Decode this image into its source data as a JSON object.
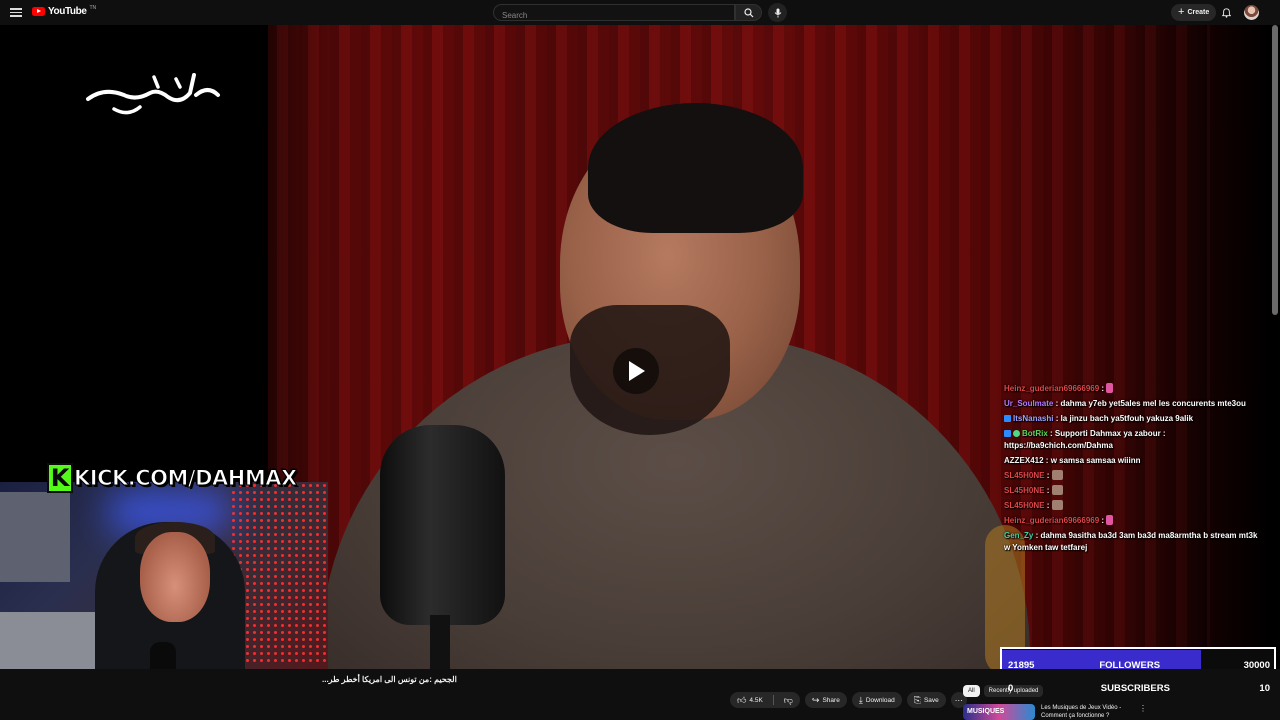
{
  "header": {
    "logo_text": "YouTube",
    "logo_region": "TN",
    "search_placeholder": "Search",
    "create_label": "Create",
    "icons": [
      "menu-icon",
      "search-icon",
      "mic-icon",
      "bell-icon"
    ]
  },
  "overlay": {
    "kick_url": "KICK.COM/DAHMAX"
  },
  "chat": [
    {
      "user": "Heinz_guderian69666969",
      "color": "#e0464a",
      "badge": "",
      "text": "",
      "emote": "pink"
    },
    {
      "user": "Ur_Soulmate",
      "color": "#b07cff",
      "badge": "",
      "text": "dahma y7eb yet5ales mel les concurents mte3ou",
      "emote": ""
    },
    {
      "user": "ItsNanashi",
      "color": "#9aa2ff",
      "badge": "square",
      "text": "la jinzu bach ya5tfouh yakuza 9alik",
      "emote": ""
    },
    {
      "user": "BotRix",
      "color": "#5cd65c",
      "badge": "both",
      "text": "Supporti Dahmax ya zabour : https://ba9chich.com/Dahma",
      "emote": ""
    },
    {
      "user": "AZZEX412",
      "color": "#f5f5f5",
      "badge": "",
      "text": "w samsa samsaa wiiinn",
      "emote": ""
    },
    {
      "user": "SL45H0NE",
      "color": "#e0464a",
      "badge": "",
      "text": "",
      "emote": "brown"
    },
    {
      "user": "SL45H0NE",
      "color": "#e0464a",
      "badge": "",
      "text": "",
      "emote": "brown"
    },
    {
      "user": "SL45H0NE",
      "color": "#e0464a",
      "badge": "",
      "text": "",
      "emote": "brown"
    },
    {
      "user": "Heinz_guderian69666969",
      "color": "#e0464a",
      "badge": "",
      "text": "",
      "emote": "pink"
    },
    {
      "user": "Gen_Zy",
      "color": "#3fd1a6",
      "badge": "",
      "text": "dahma 9asitha ba3d 3am ba3d ma8armtha b stream mt3k w Yomken taw tetfarej",
      "emote": ""
    }
  ],
  "stats": {
    "followers_count": "21895",
    "followers_label": "FOLLOWERS",
    "followers_goal": "30000",
    "followers_progress": 0.73,
    "subscribers_count": "0",
    "subscribers_label": "SUBSCRIBERS",
    "subscribers_goal": "10",
    "subscribers_progress": 0.0
  },
  "video": {
    "title": "الجحيم :من تونس الى امريكا أخطر طر..."
  },
  "actions": {
    "like_count": "4.5K",
    "share": "Share",
    "download": "Download",
    "save": "Save"
  },
  "chips": {
    "all": "All",
    "recent": "Recently uploaded"
  },
  "recommendation": {
    "thumb_text": "MUSIQUES",
    "title": "Les Musiques de Jeux Vidéo - Comment ça fonctionne ?"
  },
  "colors": {
    "accent_red": "#ff0000",
    "kick_green": "#53fc18",
    "followers_bar": "#3a2ccc"
  }
}
